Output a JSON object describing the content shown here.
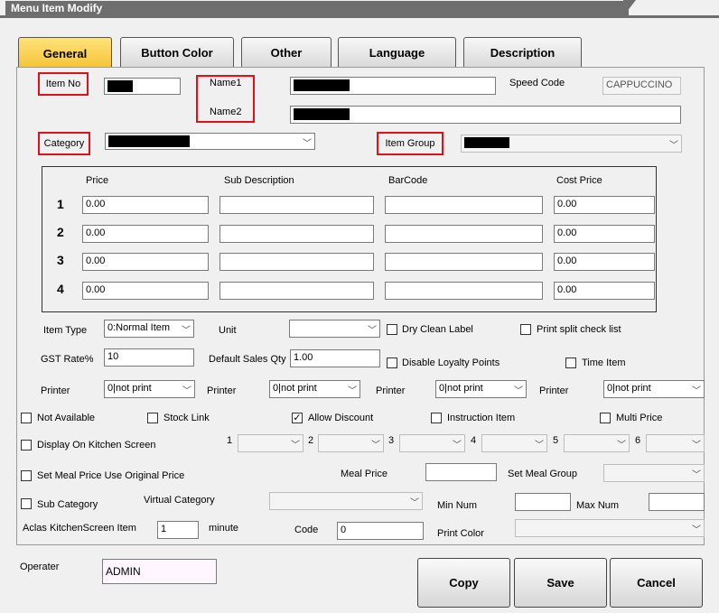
{
  "window": {
    "title": "Menu Item Modify"
  },
  "tabs": [
    "General",
    "Button Color",
    "Other",
    "Language",
    "Description"
  ],
  "top": {
    "item_no_label": "Item No",
    "name1_label": "Name1",
    "name2_label": "Name2",
    "speed_code_label": "Speed Code",
    "speed_code_value": "CAPPUCCINO",
    "category_label": "Category",
    "item_group_label": "Item Group"
  },
  "prices": {
    "headers": [
      "Price",
      "Sub Description",
      "BarCode",
      "Cost Price"
    ],
    "rows": [
      {
        "num": "1",
        "price": "0.00",
        "sub": "",
        "barcode": "",
        "cost": "0.00"
      },
      {
        "num": "2",
        "price": "0.00",
        "sub": "",
        "barcode": "",
        "cost": "0.00"
      },
      {
        "num": "3",
        "price": "0.00",
        "sub": "",
        "barcode": "",
        "cost": "0.00"
      },
      {
        "num": "4",
        "price": "0.00",
        "sub": "",
        "barcode": "",
        "cost": "0.00"
      }
    ]
  },
  "settings": {
    "item_type_label": "Item Type",
    "item_type_value": "0:Normal Item",
    "unit_label": "Unit",
    "unit_value": "",
    "dry_clean_label": "Dry Clean Label",
    "print_split_label": "Print split check list",
    "gst_label": "GST Rate%",
    "gst_value": "10",
    "default_qty_label": "Default Sales Qty",
    "default_qty_value": "1.00",
    "disable_loyalty_label": "Disable Loyalty Points",
    "time_item_label": "Time Item",
    "printer_label": "Printer",
    "printer_values": [
      "0|not print",
      "0|not print",
      "0|not print",
      "0|not print"
    ]
  },
  "flags": {
    "not_available": "Not Available",
    "stock_link": "Stock Link",
    "allow_discount": "Allow Discount",
    "instruction_item": "Instruction Item",
    "multi_price": "Multi Price",
    "display_kitchen": "Display On Kitchen Screen",
    "kitchen_nums": [
      "1",
      "2",
      "3",
      "4",
      "5",
      "6"
    ],
    "set_meal_price": "Set Meal Price Use Original Price",
    "meal_price_label": "Meal Price",
    "set_meal_group_label": "Set Meal Group",
    "sub_category": "Sub Category",
    "virtual_category_label": "Virtual Category",
    "min_num_label": "Min Num",
    "max_num_label": "Max Num",
    "aclas_label": "Aclas KitchenScreen Item",
    "aclas_value": "1",
    "minute_label": "minute",
    "code_label": "Code",
    "code_value": "0",
    "print_color_label": "Print Color"
  },
  "footer": {
    "operater_label": "Operater",
    "operater_value": "ADMIN",
    "copy": "Copy",
    "save": "Save",
    "cancel": "Cancel"
  }
}
